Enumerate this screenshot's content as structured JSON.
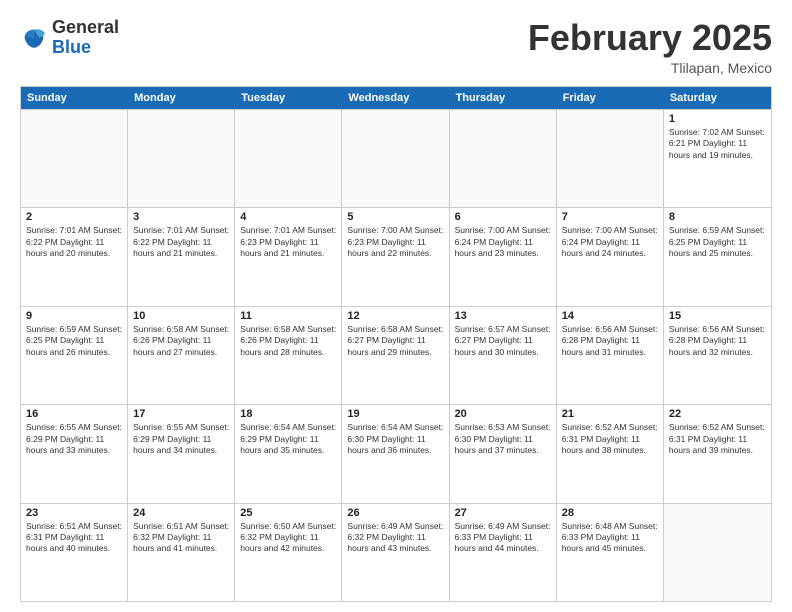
{
  "logo": {
    "text_general": "General",
    "text_blue": "Blue"
  },
  "header": {
    "month": "February 2025",
    "location": "Tlilapan, Mexico"
  },
  "weekdays": [
    "Sunday",
    "Monday",
    "Tuesday",
    "Wednesday",
    "Thursday",
    "Friday",
    "Saturday"
  ],
  "rows": [
    [
      {
        "day": "",
        "info": ""
      },
      {
        "day": "",
        "info": ""
      },
      {
        "day": "",
        "info": ""
      },
      {
        "day": "",
        "info": ""
      },
      {
        "day": "",
        "info": ""
      },
      {
        "day": "",
        "info": ""
      },
      {
        "day": "1",
        "info": "Sunrise: 7:02 AM\nSunset: 6:21 PM\nDaylight: 11 hours and 19 minutes."
      }
    ],
    [
      {
        "day": "2",
        "info": "Sunrise: 7:01 AM\nSunset: 6:22 PM\nDaylight: 11 hours and 20 minutes."
      },
      {
        "day": "3",
        "info": "Sunrise: 7:01 AM\nSunset: 6:22 PM\nDaylight: 11 hours and 21 minutes."
      },
      {
        "day": "4",
        "info": "Sunrise: 7:01 AM\nSunset: 6:23 PM\nDaylight: 11 hours and 21 minutes."
      },
      {
        "day": "5",
        "info": "Sunrise: 7:00 AM\nSunset: 6:23 PM\nDaylight: 11 hours and 22 minutes."
      },
      {
        "day": "6",
        "info": "Sunrise: 7:00 AM\nSunset: 6:24 PM\nDaylight: 11 hours and 23 minutes."
      },
      {
        "day": "7",
        "info": "Sunrise: 7:00 AM\nSunset: 6:24 PM\nDaylight: 11 hours and 24 minutes."
      },
      {
        "day": "8",
        "info": "Sunrise: 6:59 AM\nSunset: 6:25 PM\nDaylight: 11 hours and 25 minutes."
      }
    ],
    [
      {
        "day": "9",
        "info": "Sunrise: 6:59 AM\nSunset: 6:25 PM\nDaylight: 11 hours and 26 minutes."
      },
      {
        "day": "10",
        "info": "Sunrise: 6:58 AM\nSunset: 6:26 PM\nDaylight: 11 hours and 27 minutes."
      },
      {
        "day": "11",
        "info": "Sunrise: 6:58 AM\nSunset: 6:26 PM\nDaylight: 11 hours and 28 minutes."
      },
      {
        "day": "12",
        "info": "Sunrise: 6:58 AM\nSunset: 6:27 PM\nDaylight: 11 hours and 29 minutes."
      },
      {
        "day": "13",
        "info": "Sunrise: 6:57 AM\nSunset: 6:27 PM\nDaylight: 11 hours and 30 minutes."
      },
      {
        "day": "14",
        "info": "Sunrise: 6:56 AM\nSunset: 6:28 PM\nDaylight: 11 hours and 31 minutes."
      },
      {
        "day": "15",
        "info": "Sunrise: 6:56 AM\nSunset: 6:28 PM\nDaylight: 11 hours and 32 minutes."
      }
    ],
    [
      {
        "day": "16",
        "info": "Sunrise: 6:55 AM\nSunset: 6:29 PM\nDaylight: 11 hours and 33 minutes."
      },
      {
        "day": "17",
        "info": "Sunrise: 6:55 AM\nSunset: 6:29 PM\nDaylight: 11 hours and 34 minutes."
      },
      {
        "day": "18",
        "info": "Sunrise: 6:54 AM\nSunset: 6:29 PM\nDaylight: 11 hours and 35 minutes."
      },
      {
        "day": "19",
        "info": "Sunrise: 6:54 AM\nSunset: 6:30 PM\nDaylight: 11 hours and 36 minutes."
      },
      {
        "day": "20",
        "info": "Sunrise: 6:53 AM\nSunset: 6:30 PM\nDaylight: 11 hours and 37 minutes."
      },
      {
        "day": "21",
        "info": "Sunrise: 6:52 AM\nSunset: 6:31 PM\nDaylight: 11 hours and 38 minutes."
      },
      {
        "day": "22",
        "info": "Sunrise: 6:52 AM\nSunset: 6:31 PM\nDaylight: 11 hours and 39 minutes."
      }
    ],
    [
      {
        "day": "23",
        "info": "Sunrise: 6:51 AM\nSunset: 6:31 PM\nDaylight: 11 hours and 40 minutes."
      },
      {
        "day": "24",
        "info": "Sunrise: 6:51 AM\nSunset: 6:32 PM\nDaylight: 11 hours and 41 minutes."
      },
      {
        "day": "25",
        "info": "Sunrise: 6:50 AM\nSunset: 6:32 PM\nDaylight: 11 hours and 42 minutes."
      },
      {
        "day": "26",
        "info": "Sunrise: 6:49 AM\nSunset: 6:32 PM\nDaylight: 11 hours and 43 minutes."
      },
      {
        "day": "27",
        "info": "Sunrise: 6:49 AM\nSunset: 6:33 PM\nDaylight: 11 hours and 44 minutes."
      },
      {
        "day": "28",
        "info": "Sunrise: 6:48 AM\nSunset: 6:33 PM\nDaylight: 11 hours and 45 minutes."
      },
      {
        "day": "",
        "info": ""
      }
    ]
  ]
}
